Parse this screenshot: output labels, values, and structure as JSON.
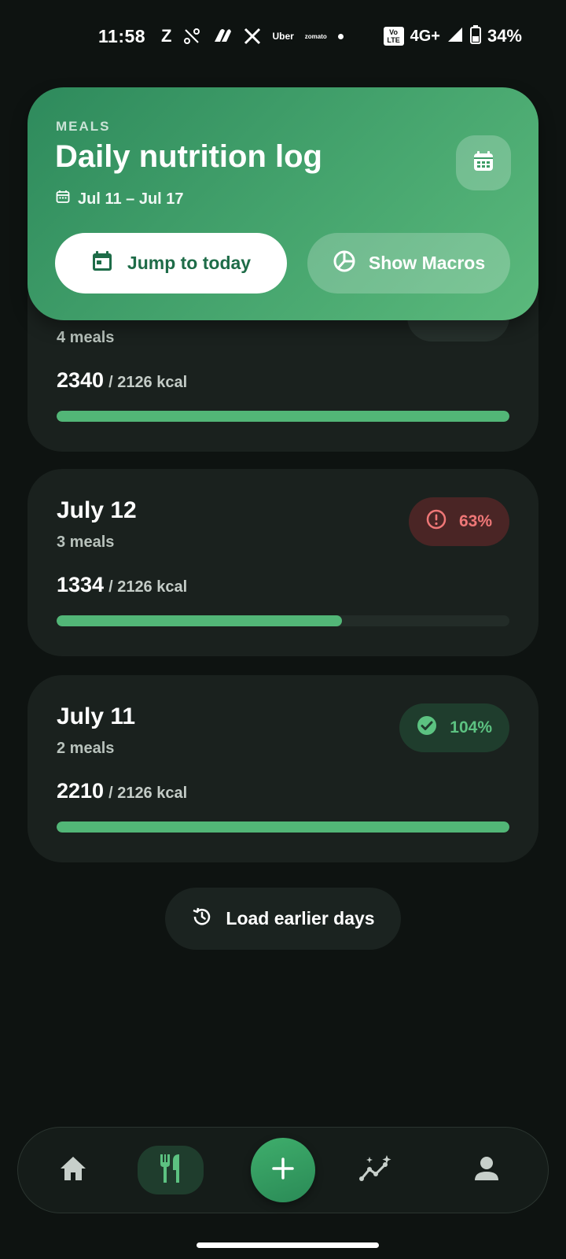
{
  "status_bar": {
    "time": "11:58",
    "app_icons": [
      "Z",
      "Uber",
      "zomato"
    ],
    "volte": "Vo\nLTE",
    "network": "4G+",
    "battery": "34%"
  },
  "header": {
    "eyebrow": "MEALS",
    "title": "Daily nutrition log",
    "date_range": "Jul 11 – Jul 17",
    "jump_today_label": "Jump to today",
    "show_macros_label": "Show Macros"
  },
  "days": [
    {
      "title": "",
      "meals": "4 meals",
      "kcal": "2340",
      "kcal_target": "/ 2126 kcal",
      "progress": 1.0,
      "status": "ok",
      "percent": ""
    },
    {
      "title": "July 12",
      "meals": "3 meals",
      "kcal": "1334",
      "kcal_target": "/ 2126 kcal",
      "progress": 0.63,
      "status": "warn",
      "percent": "63%"
    },
    {
      "title": "July 11",
      "meals": "2 meals",
      "kcal": "2210",
      "kcal_target": "/ 2126 kcal",
      "progress": 1.0,
      "status": "ok",
      "percent": "104%"
    }
  ],
  "load_earlier_label": "Load earlier days",
  "nav": {
    "items": [
      "home-icon",
      "meals-icon",
      "add-icon",
      "insights-icon",
      "profile-icon"
    ],
    "active": "meals"
  },
  "colors": {
    "accent": "#52b677",
    "warn": "#ef7777",
    "card": "#1a211e",
    "background": "#0e1311"
  }
}
